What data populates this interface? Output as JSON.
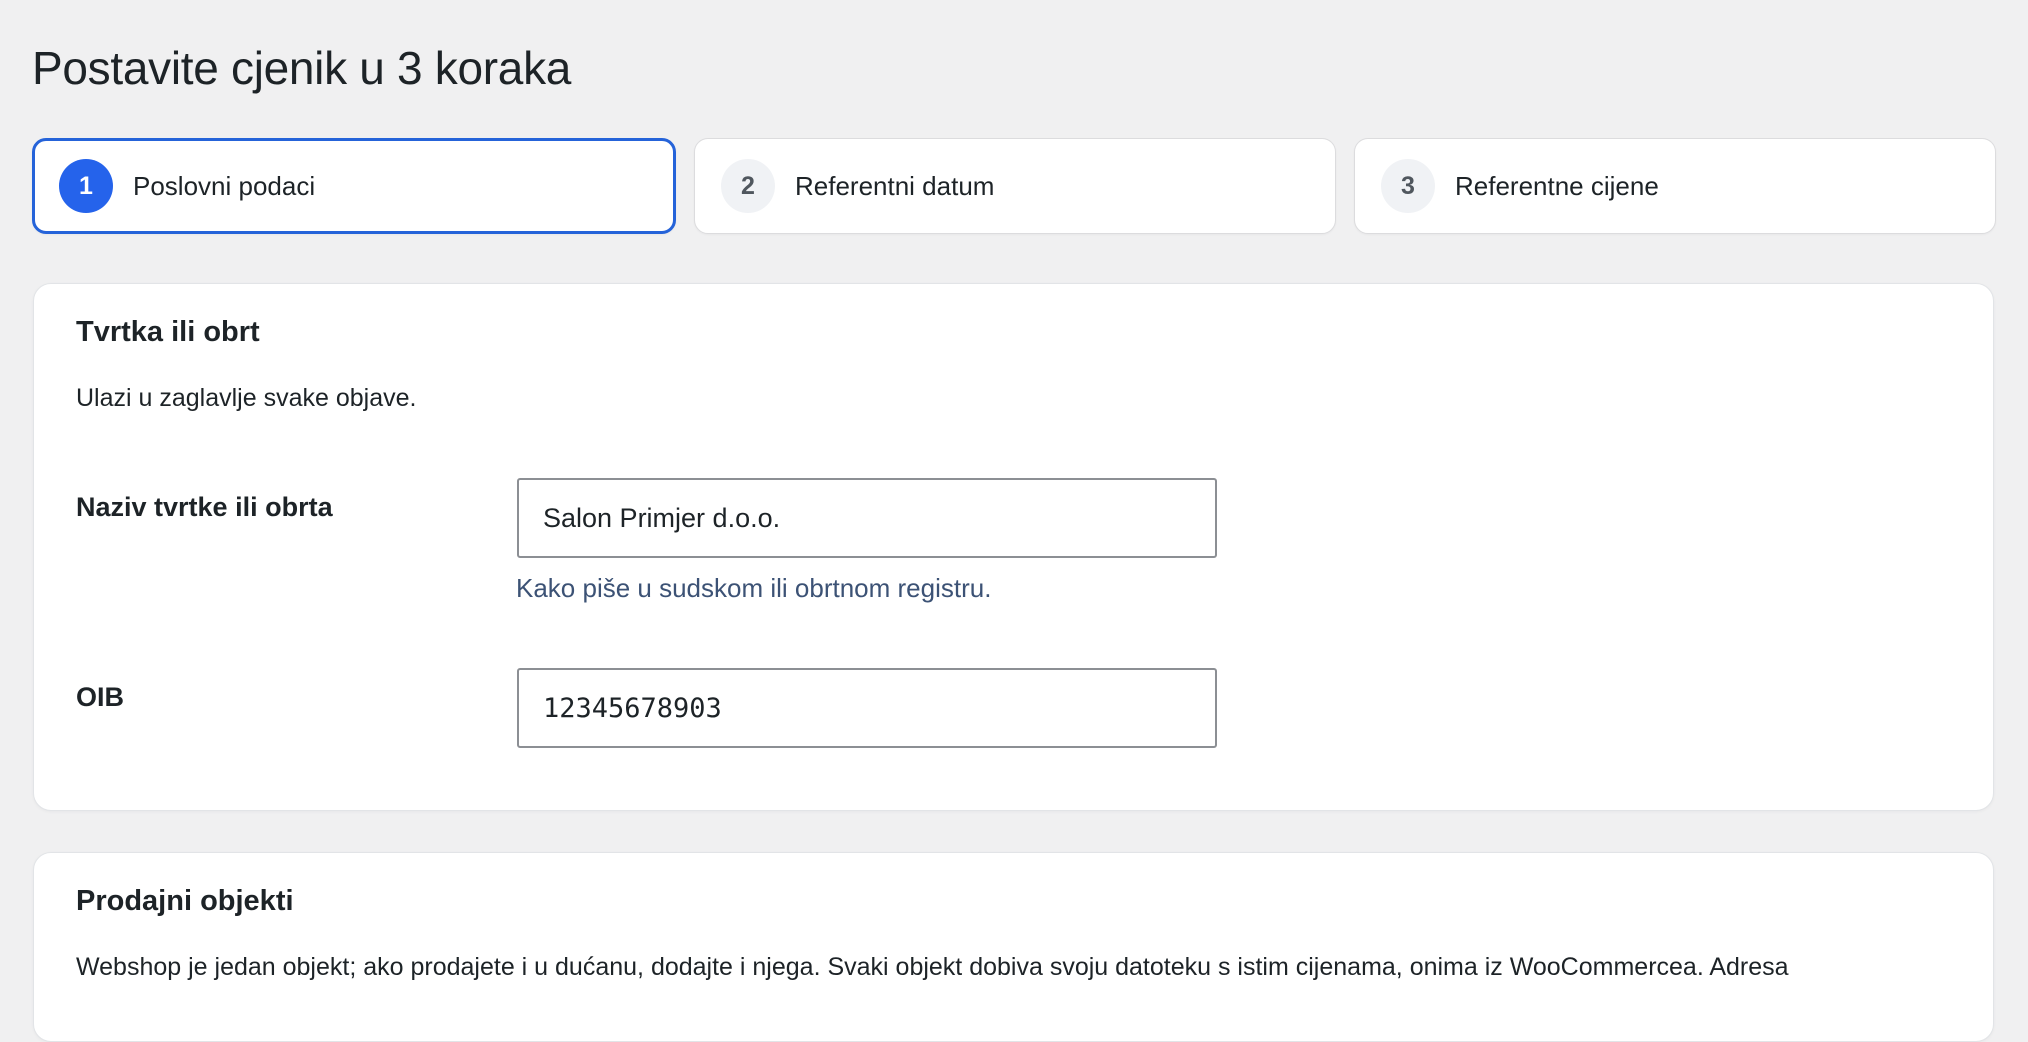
{
  "page": {
    "title": "Postavite cjenik u 3 koraka"
  },
  "steps": [
    {
      "number": "1",
      "label": "Poslovni podaci",
      "active": true
    },
    {
      "number": "2",
      "label": "Referentni datum",
      "active": false
    },
    {
      "number": "3",
      "label": "Referentne cijene",
      "active": false
    }
  ],
  "company_card": {
    "heading": "Tvrtka ili obrt",
    "description": "Ulazi u zaglavlje svake objave.",
    "name_field": {
      "label": "Naziv tvrtke ili obrta",
      "value": "Salon Primjer d.o.o.",
      "help": "Kako piše u sudskom ili obrtnom registru."
    },
    "oib_field": {
      "label": "OIB",
      "value": "12345678903"
    }
  },
  "outlets_card": {
    "heading": "Prodajni objekti",
    "description": "Webshop je jedan objekt; ako prodajete i u dućanu, dodajte i njega. Svaki objekt dobiva svoju datoteku s istim cijenama, onima iz WooCommercea. Adresa"
  },
  "colors": {
    "accent": "#2563eb",
    "background": "#f0f0f1",
    "help_text": "#3c5275"
  }
}
